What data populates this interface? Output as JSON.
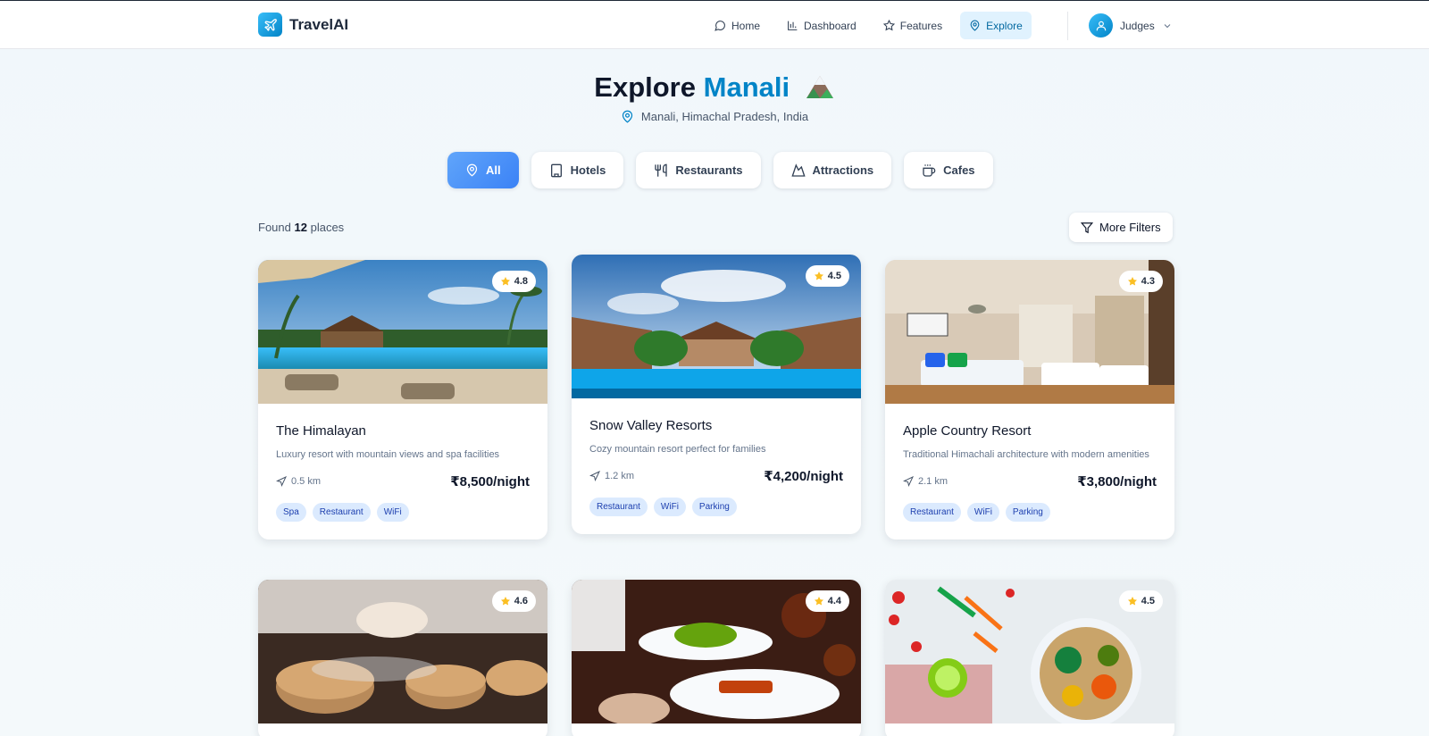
{
  "nav": {
    "brand": "TravelAI",
    "links": [
      {
        "label": "Home",
        "icon": "chat-bubble-icon"
      },
      {
        "label": "Dashboard",
        "icon": "bar-chart-icon"
      },
      {
        "label": "Features",
        "icon": "star-icon"
      },
      {
        "label": "Explore",
        "icon": "map-pin-icon",
        "active": true
      }
    ],
    "user": "Judges"
  },
  "hero": {
    "title_prefix": "Explore",
    "title_city": "Manali",
    "location": "Manali, Himachal Pradesh, India"
  },
  "filters": {
    "chips": [
      {
        "label": "All",
        "icon": "map-pin-icon",
        "active": true
      },
      {
        "label": "Hotels",
        "icon": "building-icon"
      },
      {
        "label": "Restaurants",
        "icon": "utensils-icon"
      },
      {
        "label": "Attractions",
        "icon": "mountain-icon"
      },
      {
        "label": "Cafes",
        "icon": "coffee-icon"
      }
    ],
    "found_prefix": "Found",
    "found_count": "12",
    "found_suffix": "places",
    "more_filters": "More Filters"
  },
  "places": [
    {
      "name": "The Himalayan",
      "desc": "Luxury resort with mountain views and spa facilities",
      "rating": "4.8",
      "distance": "0.5 km",
      "price": "₹8,500/night",
      "tags": [
        "Spa",
        "Restaurant",
        "WiFi"
      ]
    },
    {
      "name": "Snow Valley Resorts",
      "desc": "Cozy mountain resort perfect for families",
      "rating": "4.5",
      "distance": "1.2 km",
      "price": "₹4,200/night",
      "tags": [
        "Restaurant",
        "WiFi",
        "Parking"
      ]
    },
    {
      "name": "Apple Country Resort",
      "desc": "Traditional Himachali architecture with modern amenities",
      "rating": "4.3",
      "distance": "2.1 km",
      "price": "₹3,800/night",
      "tags": [
        "Restaurant",
        "WiFi",
        "Parking"
      ]
    },
    {
      "rating": "4.6"
    },
    {
      "rating": "4.4"
    },
    {
      "rating": "4.5"
    }
  ],
  "colors": {
    "accent": "#0284c7",
    "chip_active": "#3b82f6",
    "tag_bg": "#dbeafe",
    "star": "#fbbf24"
  }
}
